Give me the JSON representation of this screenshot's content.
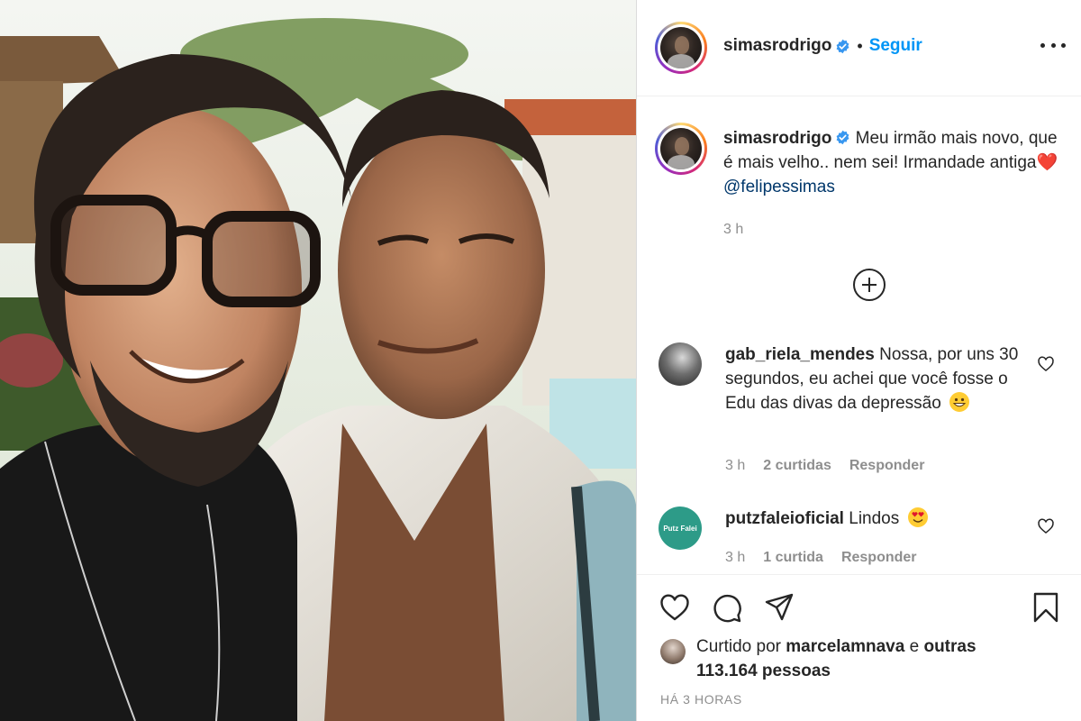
{
  "post": {
    "author": {
      "username": "simasrodrigo",
      "verified": true,
      "follow_label": "Seguir",
      "separator": "•"
    },
    "caption": {
      "username": "simasrodrigo",
      "text_before": "Meu irmão mais novo, que é mais velho.. nem sei! Irmandade antiga",
      "emoji": "❤️",
      "mention": "@felipessimas",
      "time": "3 h"
    },
    "comments": [
      {
        "username": "gab_riela_mendes",
        "text": "Nossa, por uns 30 segundos, eu achei que você fosse o Edu das divas da depressão",
        "emoji": "grinning-face",
        "time": "3 h",
        "likes": "2 curtidas",
        "reply_label": "Responder"
      },
      {
        "username": "putzfaleioficial",
        "avatar_text": "Putz Falei",
        "text": "Lindos",
        "emoji": "heart-eyes-face",
        "time": "3 h",
        "likes": "1 curtida",
        "reply_label": "Responder"
      }
    ],
    "likes": {
      "prefix": "Curtido por",
      "user": "marcelamnava",
      "connector": "e",
      "others": "outras 113.164 pessoas"
    },
    "posted_ago": "HÁ 3 HORAS"
  }
}
